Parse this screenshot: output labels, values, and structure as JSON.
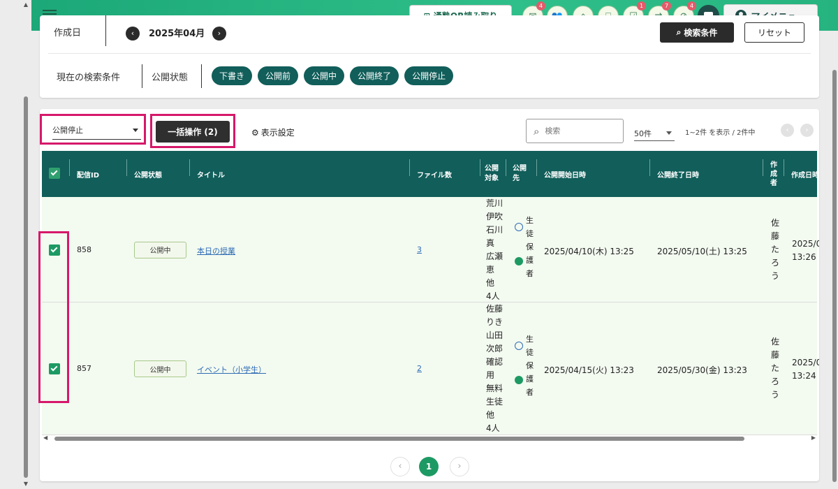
{
  "header": {
    "qr_label": "通塾QR読み取り",
    "icons": [
      {
        "name": "message-icon",
        "glyph": "✉",
        "badge": "4"
      },
      {
        "name": "group-icon",
        "glyph": "👥",
        "badge": ""
      },
      {
        "name": "school-icon",
        "glyph": "⌂",
        "badge": ""
      },
      {
        "name": "gift-icon",
        "glyph": "⎕",
        "badge": ""
      },
      {
        "name": "checklist-icon",
        "glyph": "☑",
        "badge": "1"
      },
      {
        "name": "exchange-icon",
        "glyph": "⇄",
        "badge": "7"
      },
      {
        "name": "timer-off-icon",
        "glyph": "⊘",
        "badge": "4"
      }
    ],
    "my_menu_label": "マイメニュー"
  },
  "search": {
    "date_label": "作成日",
    "month": "2025年04月",
    "search_button": "検索条件",
    "reset_button": "リセット",
    "current_conditions_label": "現在の検索条件",
    "status_label": "公開状態",
    "chips": [
      "下書き",
      "公開前",
      "公開中",
      "公開終了",
      "公開停止"
    ]
  },
  "toolbar": {
    "bulk_select_value": "公開停止",
    "bulk_button": "一括操作 (2)",
    "display_settings": "表示設定",
    "search_placeholder": "検索",
    "per_page": "50件",
    "range_text": "1~2件 を表示 / 2件中"
  },
  "table": {
    "columns": {
      "id": "配信ID",
      "status": "公開状態",
      "title": "タイトル",
      "files": "ファイル数",
      "target": "公開対象",
      "audience": "公開先",
      "start": "公開開始日時",
      "end": "公開終了日時",
      "author": "作成者",
      "created": "作成日時"
    },
    "rows": [
      {
        "checked": true,
        "id": "858",
        "status": "公開中",
        "title": "本日の授業",
        "files": "3",
        "target": [
          "荒川",
          "伊吹",
          "石川",
          "真",
          "広瀬",
          "恵",
          "他",
          "4人"
        ],
        "audience_student": [
          "生",
          "徒"
        ],
        "audience_parent": [
          "保",
          "護",
          "者"
        ],
        "start": "2025/04/10(木) 13:25",
        "end": "2025/05/10(土) 13:25",
        "author": [
          "佐",
          "藤",
          "た",
          "ろ",
          "う"
        ],
        "created": [
          "2025/0",
          "13:26"
        ]
      },
      {
        "checked": true,
        "id": "857",
        "status": "公開中",
        "title": "イベント（小学生）",
        "files": "2",
        "target": [
          "佐藤",
          "りき",
          "山田",
          "次郎",
          "確認",
          "用",
          "無料",
          "生徒",
          "他",
          "4人"
        ],
        "audience_student": [
          "生",
          "徒"
        ],
        "audience_parent": [
          "保",
          "護",
          "者"
        ],
        "start": "2025/04/15(火) 13:23",
        "end": "2025/05/30(金) 13:23",
        "author": [
          "佐",
          "藤",
          "た",
          "ろ",
          "う"
        ],
        "created": [
          "2025/0",
          "13:24"
        ]
      }
    ]
  },
  "pagination": {
    "current": "1",
    "prev": "‹",
    "next": "›"
  },
  "colors": {
    "brand_green": "#1ca878",
    "table_header": "#115e5a",
    "highlight": "#d6186a"
  }
}
